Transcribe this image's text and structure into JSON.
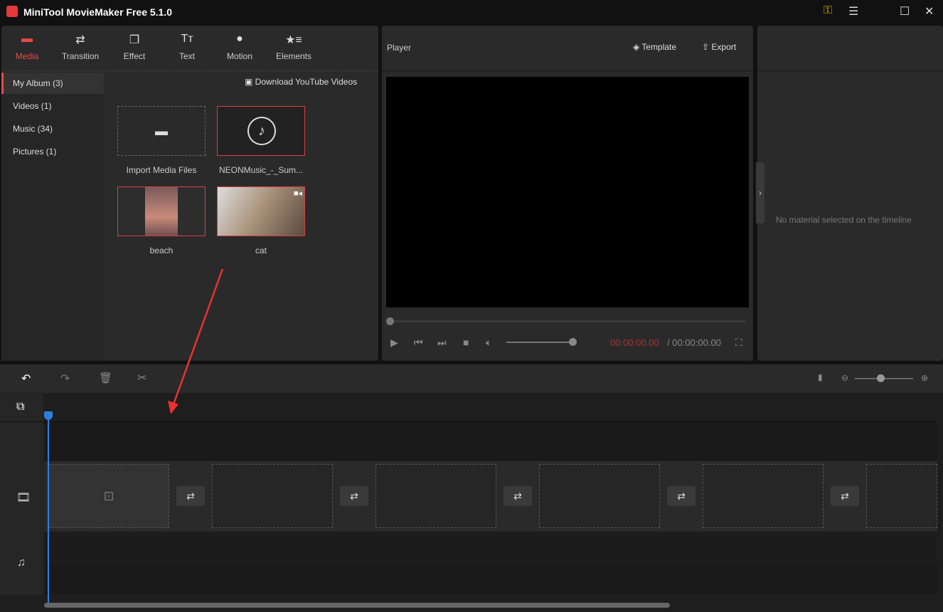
{
  "app": {
    "title": "MiniTool MovieMaker Free 5.1.0"
  },
  "tabs": [
    {
      "label": "Media",
      "icon": "folder-icon",
      "active": true
    },
    {
      "label": "Transition",
      "icon": "swap-icon"
    },
    {
      "label": "Effect",
      "icon": "effect-icon"
    },
    {
      "label": "Text",
      "icon": "text-icon"
    },
    {
      "label": "Motion",
      "icon": "motion-icon"
    },
    {
      "label": "Elements",
      "icon": "elements-icon"
    }
  ],
  "sidebar": {
    "items": [
      {
        "label": "My Album (3)",
        "active": true
      },
      {
        "label": "Videos (1)"
      },
      {
        "label": "Music (34)"
      },
      {
        "label": "Pictures (1)"
      }
    ]
  },
  "media": {
    "download_label": "Download YouTube Videos",
    "items": [
      {
        "label": "Import Media Files"
      },
      {
        "label": "NEONMusic_-_Sum..."
      },
      {
        "label": "beach"
      },
      {
        "label": "cat"
      }
    ]
  },
  "player": {
    "title": "Player",
    "template_label": "Template",
    "export_label": "Export",
    "current_time": "00:00:00.00",
    "total_time": "/ 00:00:00.00",
    "volume": 0.95,
    "progress": 0
  },
  "properties": {
    "empty_text": "No material selected on the timeline"
  },
  "colors": {
    "accent": "#e84b44",
    "playhead": "#2b7fe0"
  }
}
